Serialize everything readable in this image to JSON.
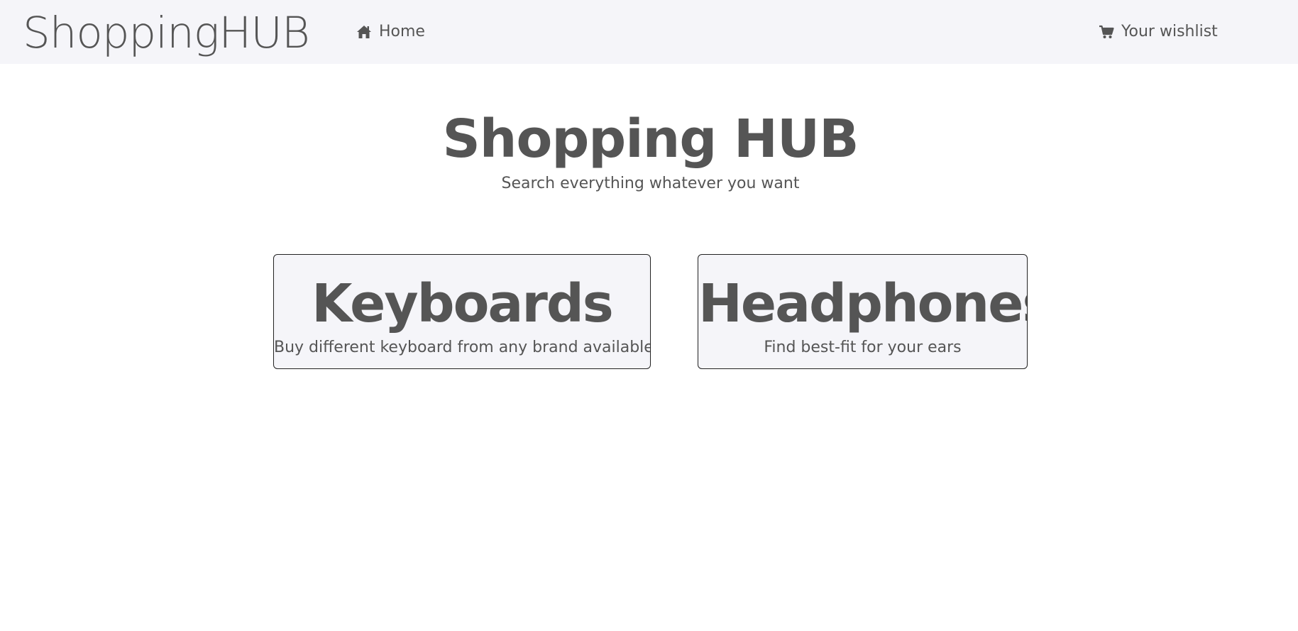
{
  "navbar": {
    "brand": "ShoppingHUB",
    "home": {
      "icon": "home-icon",
      "label": "Home"
    },
    "wishlist": {
      "icon": "cart-icon",
      "label": "Your wishlist"
    },
    "background": "#f5f5f9"
  },
  "hero": {
    "title": "Shopping HUB",
    "subtitle": "Search everything whatever you want"
  },
  "categories": [
    {
      "title": "Keyboards",
      "description": "Buy different keyboard from any brand available"
    },
    {
      "title": "Headphones",
      "description": "Find best-fit for your ears"
    }
  ],
  "colors": {
    "text": "#555555",
    "card_background": "#f5f5f9",
    "card_border": "#222222"
  }
}
